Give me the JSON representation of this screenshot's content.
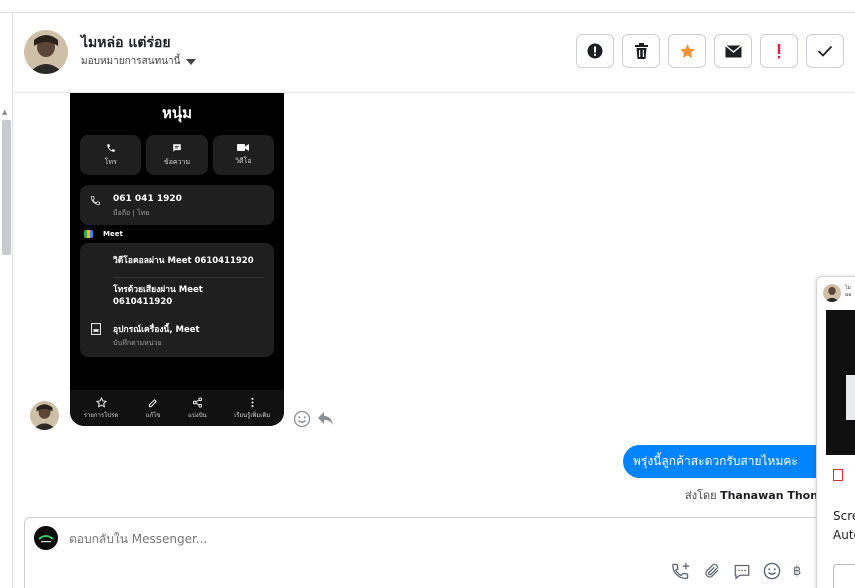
{
  "header": {
    "contact_name": "ไมหล่อ แต่ร่อย",
    "assign_label": "มอบหมายการสนทนานี้"
  },
  "actions": [
    {
      "name": "spam",
      "icon": "alert-circle-icon"
    },
    {
      "name": "delete",
      "icon": "trash-icon"
    },
    {
      "name": "star",
      "icon": "star-icon",
      "color": "#f7923b"
    },
    {
      "name": "mark-unread",
      "icon": "envelope-icon"
    },
    {
      "name": "follow-up",
      "icon": "exclamation-icon",
      "color": "#e41e3f"
    },
    {
      "name": "done",
      "icon": "check-icon"
    }
  ],
  "phone_card": {
    "name": "หนุ่ม",
    "buttons": [
      "โทร",
      "ข้อความ",
      "วิดีโอ"
    ],
    "number": "061 041 1920",
    "number_sub": "มือถือ | ไทย",
    "meet_label": "Meet",
    "meet_options": [
      "วิดีโอคอลผ่าน Meet 0610411920",
      "โทรด้วยเสียงผ่าน Meet 0610411920",
      "อุปกรณ์เครื่องนี้, Meet"
    ],
    "meet_options_sub": "บันทึกตามหน่วย",
    "bottom_nav": [
      "รายการโปรด",
      "แก้ไข",
      "แบ่งปัน",
      "เรียนรู้เพิ่มเติม"
    ]
  },
  "outgoing": {
    "text": "พรุ่งนี้ลูกค้าสะดวกรับสายไหมคะ",
    "sent_by_prefix": "ส่งโดย",
    "sent_by_name": "Thanawan Thon"
  },
  "composer": {
    "placeholder": "ตอบกลับใน Messenger..."
  },
  "popup": {
    "title_line1": "ไม",
    "title_line2": "มอ",
    "text_line1": "Scre",
    "text_line2": "Auto"
  },
  "colors": {
    "accent": "#0084ff",
    "star": "#f7923b",
    "followup": "#e41e3f"
  }
}
